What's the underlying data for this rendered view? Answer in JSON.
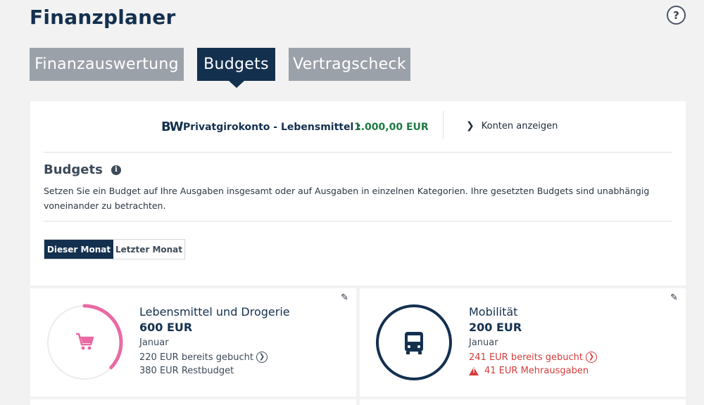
{
  "app": {
    "title": "Finanzplaner",
    "help_label": "?"
  },
  "tabs": [
    {
      "label": "Finanzauswertung",
      "active": false
    },
    {
      "label": "Budgets",
      "active": true
    },
    {
      "label": "Vertragscheck",
      "active": false
    }
  ],
  "account": {
    "logo": "BW",
    "name": "Privatgirokonto - Lebensmittel :",
    "amount": "1.000,00 EUR",
    "link": "Konten anzeigen"
  },
  "budgets_section": {
    "title": "Budgets",
    "description": "Setzen Sie ein Budget auf Ihre Ausgaben insgesamt oder auf Ausgaben in einzelnen Kategorien. Ihre gesetzten Budgets sind unabhängig voneinander zu betrachten.",
    "segments": [
      {
        "label": "Dieser Monat",
        "active": true
      },
      {
        "label": "Letzter Monat",
        "active": false
      }
    ]
  },
  "cards": [
    {
      "name": "Lebensmittel und Drogerie",
      "amount": "600 EUR",
      "month": "Januar",
      "spent": "220 EUR bereits gebucht",
      "rest": "380 EUR Restbudget",
      "progress_fraction": 0.37,
      "ring_color": "#e96aa3",
      "icon": "shopping-cart-icon",
      "over_budget": false
    },
    {
      "name": "Mobilität",
      "amount": "200 EUR",
      "month": "Januar",
      "spent": "241 EUR bereits gebucht",
      "rest": "41 EUR Mehrausgaben",
      "progress_fraction": 1.0,
      "ring_color": "#14304f",
      "icon": "bus-icon",
      "over_budget": true
    }
  ],
  "colors": {
    "primary": "#14304f",
    "positive": "#1f7a45",
    "negative": "#d63c3c",
    "inactive_tab": "#9aa1a9"
  }
}
